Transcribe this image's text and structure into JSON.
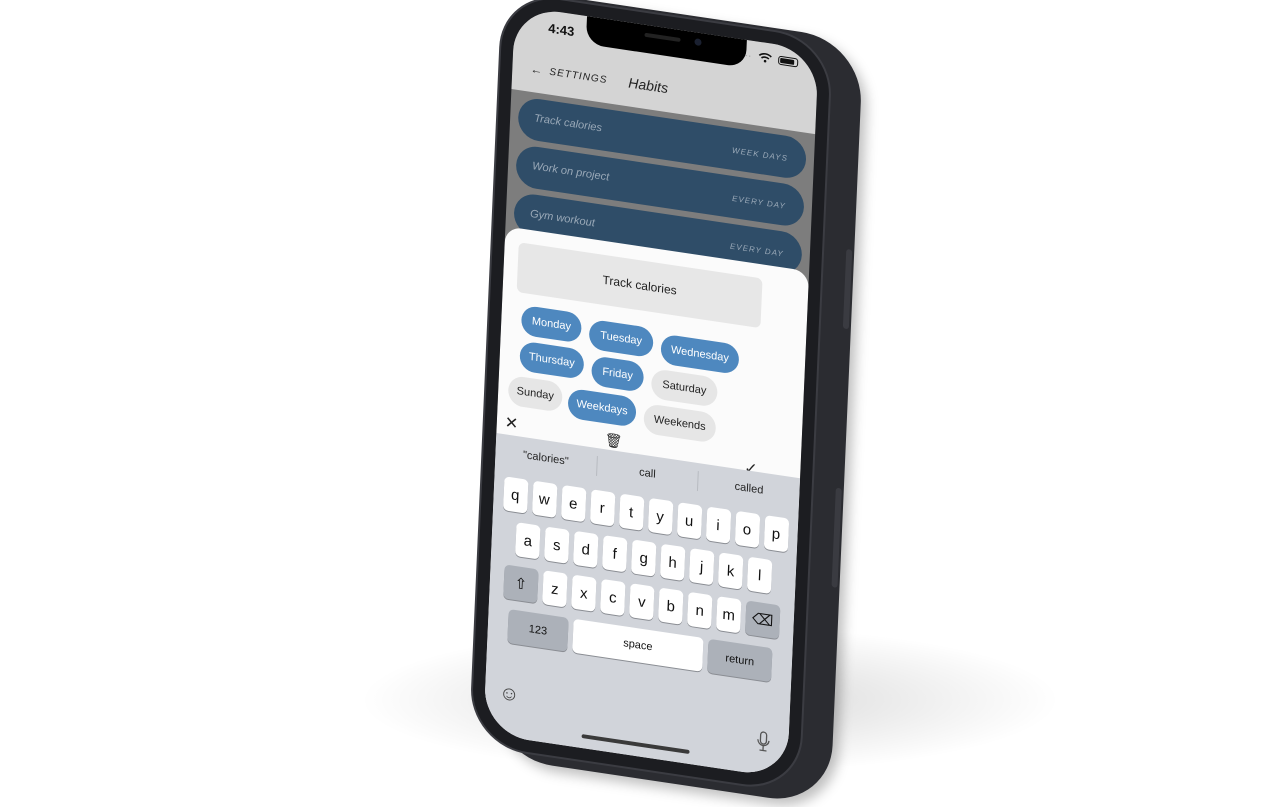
{
  "status_bar": {
    "time": "4:43",
    "wifi_icon": "wifi-icon",
    "battery_icon": "battery-icon"
  },
  "nav": {
    "back_label": "SETTINGS",
    "back_icon": "arrow-left-icon",
    "title": "Habits"
  },
  "habits": [
    {
      "name": "Track calories",
      "frequency": "WEEK DAYS"
    },
    {
      "name": "Work on project",
      "frequency": "EVERY DAY"
    },
    {
      "name": "Gym workout",
      "frequency": "EVERY DAY"
    }
  ],
  "editor": {
    "habit_name": "Track calories",
    "days": [
      {
        "label": "Monday",
        "selected": true
      },
      {
        "label": "Tuesday",
        "selected": true
      },
      {
        "label": "Wednesday",
        "selected": true
      },
      {
        "label": "Thursday",
        "selected": true
      },
      {
        "label": "Friday",
        "selected": true
      },
      {
        "label": "Saturday",
        "selected": false
      },
      {
        "label": "Sunday",
        "selected": false
      },
      {
        "label": "Weekdays",
        "selected": true
      },
      {
        "label": "Weekends",
        "selected": false
      }
    ],
    "close_glyph": "✕",
    "delete_glyph": "🗑",
    "confirm_glyph": "✓"
  },
  "keyboard": {
    "suggestions": [
      "\"calories\"",
      "call",
      "called"
    ],
    "row1": [
      "q",
      "w",
      "e",
      "r",
      "t",
      "y",
      "u",
      "i",
      "o",
      "p"
    ],
    "row2": [
      "a",
      "s",
      "d",
      "f",
      "g",
      "h",
      "j",
      "k",
      "l"
    ],
    "row3": [
      "z",
      "x",
      "c",
      "v",
      "b",
      "n",
      "m"
    ],
    "shift_glyph": "⇧",
    "backspace_glyph": "⌫",
    "numbers_label": "123",
    "space_label": "space",
    "return_label": "return",
    "emoji_glyph": "☺",
    "mic_glyph": "🎙"
  },
  "colors": {
    "selected_chip": "#4e88bf",
    "habit_card": "#2f4d68",
    "topbar": "#d4d4d4"
  }
}
